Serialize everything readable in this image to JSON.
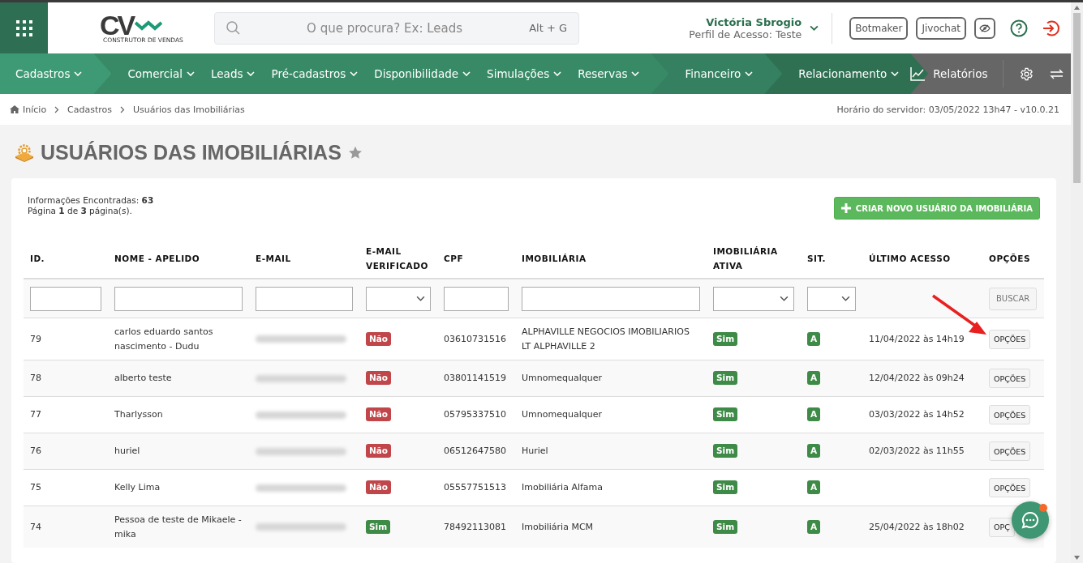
{
  "header": {
    "logo": {
      "mark": "CV",
      "tagline": "CONSTRUTOR DE VENDAS"
    },
    "search": {
      "placeholder": "O que procura? Ex: Leads",
      "shortcut": "Alt + G"
    },
    "user": {
      "name": "Victória Sbrogio",
      "profile": "Perfil de Acesso: Teste"
    },
    "buttons": [
      "Botmaker",
      "Jivochat"
    ]
  },
  "nav": {
    "groups": [
      {
        "selected": true,
        "items": [
          "Cadastros"
        ]
      },
      {
        "selected": false,
        "items": [
          "Comercial",
          "Leads",
          "Pré-cadastros",
          "Disponibilidade",
          "Simulações",
          "Reservas"
        ]
      },
      {
        "selected": false,
        "items": [
          "Financeiro"
        ]
      },
      {
        "selected": false,
        "items": [
          "Relacionamento"
        ]
      }
    ],
    "reports": "Relatórios"
  },
  "breadcrumb": [
    "Início",
    "Cadastros",
    "Usuários das Imobiliárias"
  ],
  "server_time": "Horário do servidor: 03/05/2022 13h47 - v10.0.21",
  "page_title": "USUÁRIOS DAS IMOBILIÁRIAS",
  "info": {
    "found": "Informações Encontradas: **63**",
    "page": "Página **1** de **3** página(s)."
  },
  "create_button": "CRIAR NOVO USUÁRIO DA IMOBILIÁRIA",
  "table": {
    "columns": [
      "ID.",
      "NOME - APELIDO",
      "E-MAIL",
      "E-MAIL VERIFICADO",
      "CPF",
      "IMOBILIÁRIA",
      "IMOBILIÁRIA ATIVA",
      "SIT.",
      "ÚLTIMO ACESSO",
      "OPÇÕES"
    ],
    "filters": [
      {
        "kind": "text"
      },
      {
        "kind": "text"
      },
      {
        "kind": "text"
      },
      {
        "kind": "select"
      },
      {
        "kind": "text"
      },
      {
        "kind": "text"
      },
      {
        "kind": "select"
      },
      {
        "kind": "select"
      },
      {
        "kind": "empty"
      },
      {
        "kind": "button"
      }
    ],
    "search_button": "BUSCAR",
    "rows": [
      {
        "id": "79",
        "name": "carlos eduardo santos nascimento - Dudu",
        "verified": {
          "label": "Não",
          "on": false
        },
        "cpf": "03610731516",
        "agency": "ALPHAVILLE NEGOCIOS IMOBILIARIOS LT ALPHAVILLE 2",
        "active": {
          "label": "Sim",
          "on": true
        },
        "status": "A",
        "last_access": "11/04/2022 às 14h19",
        "options": "OPÇÕES"
      },
      {
        "id": "78",
        "name": "alberto teste",
        "verified": {
          "label": "Não",
          "on": false
        },
        "cpf": "03801141519",
        "agency": "Umnomequalquer",
        "active": {
          "label": "Sim",
          "on": true
        },
        "status": "A",
        "last_access": "12/04/2022 às 09h24",
        "options": "OPÇÕES"
      },
      {
        "id": "77",
        "name": "Tharlysson",
        "verified": {
          "label": "Não",
          "on": false
        },
        "cpf": "05795337510",
        "agency": "Umnomequalquer",
        "active": {
          "label": "Sim",
          "on": true
        },
        "status": "A",
        "last_access": "03/03/2022 às 14h52",
        "options": "OPÇÕES"
      },
      {
        "id": "76",
        "name": "huriel",
        "verified": {
          "label": "Não",
          "on": false
        },
        "cpf": "06512647580",
        "agency": "Huriel",
        "active": {
          "label": "Sim",
          "on": true
        },
        "status": "A",
        "last_access": "02/03/2022 às 11h55",
        "options": "OPÇÕES"
      },
      {
        "id": "75",
        "name": "Kelly Lima",
        "verified": {
          "label": "Não",
          "on": false
        },
        "cpf": "05557751513",
        "agency": "Imobiliária Alfama",
        "active": {
          "label": "Sim",
          "on": true
        },
        "status": "A",
        "options": "OPÇÕES"
      },
      {
        "id": "74",
        "name": "Pessoa de teste de Mikaele - mika",
        "verified": {
          "label": "Sim",
          "on": true
        },
        "cpf": "78492113081",
        "agency": "Imobiliária MCM",
        "active": {
          "label": "Sim",
          "on": true
        },
        "status": "A",
        "last_access": "25/04/2022 às 18h02",
        "options": "OPÇ"
      }
    ]
  }
}
